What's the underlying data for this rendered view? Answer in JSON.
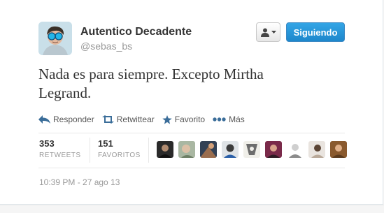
{
  "author": {
    "display_name": "Autentico Decadente",
    "username": "@sebas_bs",
    "avatar_icon": "user-avatar"
  },
  "follow_button": {
    "label": "Siguiendo",
    "color": "#2b97d9"
  },
  "user_menu_button": {
    "icon": "person-icon",
    "dropdown_icon": "caret-down-icon"
  },
  "tweet": {
    "line1": "Nada es para siempre. Excepto Mirtha",
    "line2": "Legrand."
  },
  "actions": [
    {
      "label": "Responder",
      "icon": "reply-icon"
    },
    {
      "label": "Retwittear",
      "icon": "retweet-icon"
    },
    {
      "label": "Favorito",
      "icon": "star-icon"
    },
    {
      "label": "Más",
      "icon": "more-dots-icon"
    }
  ],
  "stats": {
    "retweets": {
      "value": "353",
      "label": "RETWEETS"
    },
    "favorites": {
      "value": "151",
      "label": "FAVORITOS"
    }
  },
  "timestamp": "10:39 PM - 27 ago 13",
  "colors": {
    "accent": "#2b97d9",
    "icon_blue": "#3a6d99",
    "text": "#333333",
    "muted": "#999999"
  }
}
